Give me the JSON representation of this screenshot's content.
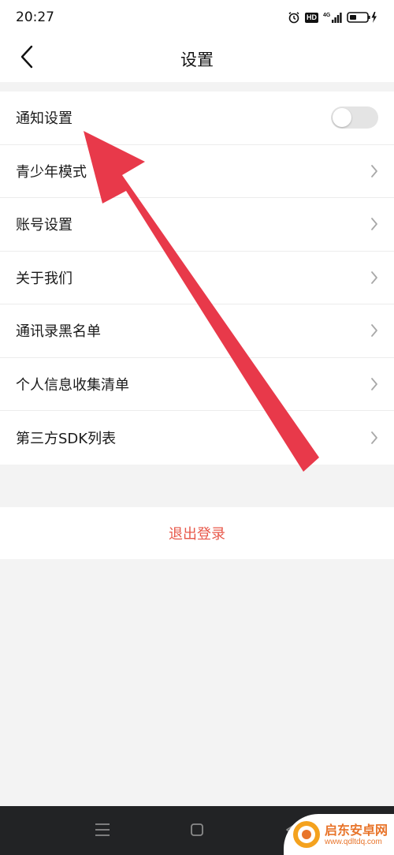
{
  "status_bar": {
    "time": "20:27",
    "hd_badge": "HD",
    "network": "4G"
  },
  "nav": {
    "title": "设置"
  },
  "settings": {
    "items": [
      {
        "label": "通知设置",
        "control": "toggle",
        "toggle_on": false
      },
      {
        "label": "青少年模式",
        "control": "chevron"
      },
      {
        "label": "账号设置",
        "control": "chevron"
      },
      {
        "label": "关于我们",
        "control": "chevron"
      },
      {
        "label": "通讯录黑名单",
        "control": "chevron"
      },
      {
        "label": "个人信息收集清单",
        "control": "chevron"
      },
      {
        "label": "第三方SDK列表",
        "control": "chevron"
      }
    ]
  },
  "logout": {
    "label": "退出登录"
  },
  "watermark": {
    "name": "启东安卓网",
    "url": "www.qdltdq.com"
  },
  "colors": {
    "accent_red": "#e8584a",
    "arrow_red": "#e8394a",
    "toggle_off": "#e4e4e4",
    "background": "#f3f3f3"
  },
  "icons": {
    "back": "chevron-left-icon",
    "row_chevron": "chevron-right-icon",
    "alarm": "alarm-clock-icon",
    "signal": "signal-icon",
    "battery": "battery-charging-icon",
    "menu": "menu-icon",
    "home": "square-home-icon",
    "back_triangle": "back-triangle-icon"
  }
}
